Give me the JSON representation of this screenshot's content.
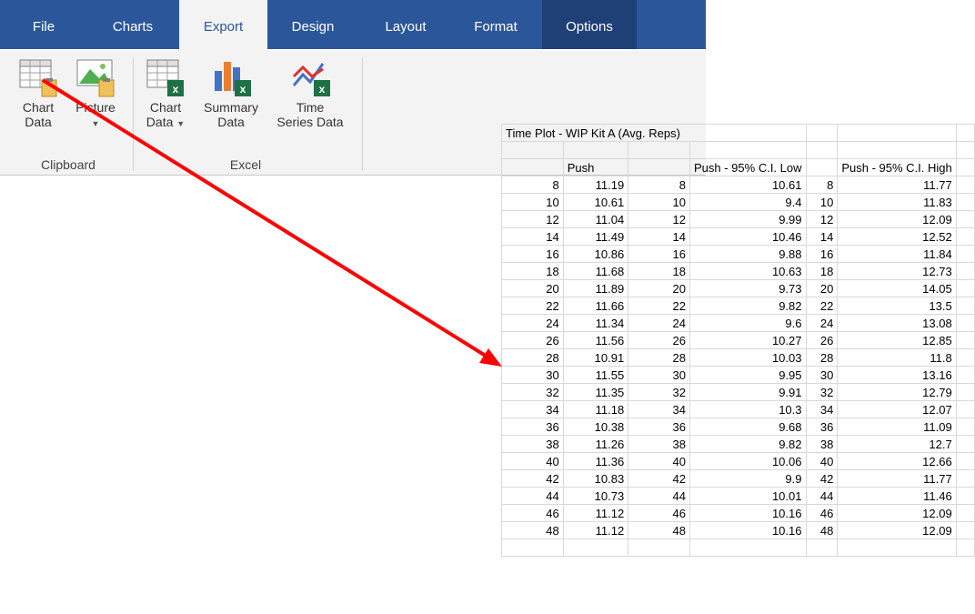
{
  "ribbon": {
    "tabs": [
      "File",
      "Charts",
      "Export",
      "Design",
      "Layout",
      "Format",
      "Options"
    ],
    "active_tab": "Export",
    "clipboard_group": "Clipboard",
    "excel_group": "Excel",
    "chart_data_label_1": "Chart",
    "chart_data_label_2": "Data",
    "picture_label": "Picture",
    "excel_chart_data_label_1": "Chart",
    "excel_chart_data_label_2": "Data",
    "summary_label_1": "Summary",
    "summary_label_2": "Data",
    "time_series_label_1": "Time",
    "time_series_label_2": "Series Data"
  },
  "sheet": {
    "title": "Time Plot - WIP Kit A (Avg. Reps)",
    "headers": [
      "Push",
      "Push - 95% C.I. Low",
      "Push - 95% C.I. High"
    ],
    "rows": [
      [
        "8",
        "11.19",
        "8",
        "10.61",
        "8",
        "11.77"
      ],
      [
        "10",
        "10.61",
        "10",
        "9.4",
        "10",
        "11.83"
      ],
      [
        "12",
        "11.04",
        "12",
        "9.99",
        "12",
        "12.09"
      ],
      [
        "14",
        "11.49",
        "14",
        "10.46",
        "14",
        "12.52"
      ],
      [
        "16",
        "10.86",
        "16",
        "9.88",
        "16",
        "11.84"
      ],
      [
        "18",
        "11.68",
        "18",
        "10.63",
        "18",
        "12.73"
      ],
      [
        "20",
        "11.89",
        "20",
        "9.73",
        "20",
        "14.05"
      ],
      [
        "22",
        "11.66",
        "22",
        "9.82",
        "22",
        "13.5"
      ],
      [
        "24",
        "11.34",
        "24",
        "9.6",
        "24",
        "13.08"
      ],
      [
        "26",
        "11.56",
        "26",
        "10.27",
        "26",
        "12.85"
      ],
      [
        "28",
        "10.91",
        "28",
        "10.03",
        "28",
        "11.8"
      ],
      [
        "30",
        "11.55",
        "30",
        "9.95",
        "30",
        "13.16"
      ],
      [
        "32",
        "11.35",
        "32",
        "9.91",
        "32",
        "12.79"
      ],
      [
        "34",
        "11.18",
        "34",
        "10.3",
        "34",
        "12.07"
      ],
      [
        "36",
        "10.38",
        "36",
        "9.68",
        "36",
        "11.09"
      ],
      [
        "38",
        "11.26",
        "38",
        "9.82",
        "38",
        "12.7"
      ],
      [
        "40",
        "11.36",
        "40",
        "10.06",
        "40",
        "12.66"
      ],
      [
        "42",
        "10.83",
        "42",
        "9.9",
        "42",
        "11.77"
      ],
      [
        "44",
        "10.73",
        "44",
        "10.01",
        "44",
        "11.46"
      ],
      [
        "46",
        "11.12",
        "46",
        "10.16",
        "46",
        "12.09"
      ],
      [
        "48",
        "11.12",
        "48",
        "10.16",
        "48",
        "12.09"
      ]
    ]
  },
  "colors": {
    "ribbon_blue": "#2b579a",
    "arrow_red": "#ff0000",
    "excel_green": "#1e7145"
  }
}
